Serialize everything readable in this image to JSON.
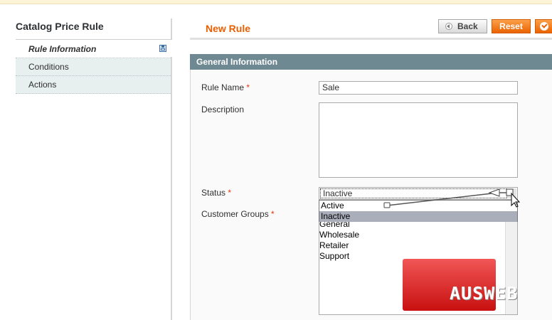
{
  "sidebar": {
    "title": "Catalog Price Rule",
    "tabs": [
      {
        "label": "Rule Information",
        "active": true
      },
      {
        "label": "Conditions",
        "active": false
      },
      {
        "label": "Actions",
        "active": false
      }
    ]
  },
  "header": {
    "title": "New Rule",
    "buttons": {
      "back": "Back",
      "reset": "Reset"
    }
  },
  "form": {
    "section_title": "General Information",
    "rule_name": {
      "label": "Rule Name",
      "value": "Sale"
    },
    "description": {
      "label": "Description",
      "value": ""
    },
    "status": {
      "label": "Status",
      "selected": "Inactive",
      "options": [
        "Active",
        "Inactive"
      ],
      "highlighted": "Inactive"
    },
    "customer_groups": {
      "label": "Customer Groups",
      "options": [
        "General",
        "Wholesale",
        "Retailer",
        "Support"
      ]
    },
    "required_marker": "*"
  },
  "watermark": {
    "text": "AUSWEB"
  },
  "colors": {
    "accent": "#eb5e00",
    "section_bar": "#6f8992",
    "highlight": "#a9aeba",
    "watermark": "#d92b2b"
  }
}
